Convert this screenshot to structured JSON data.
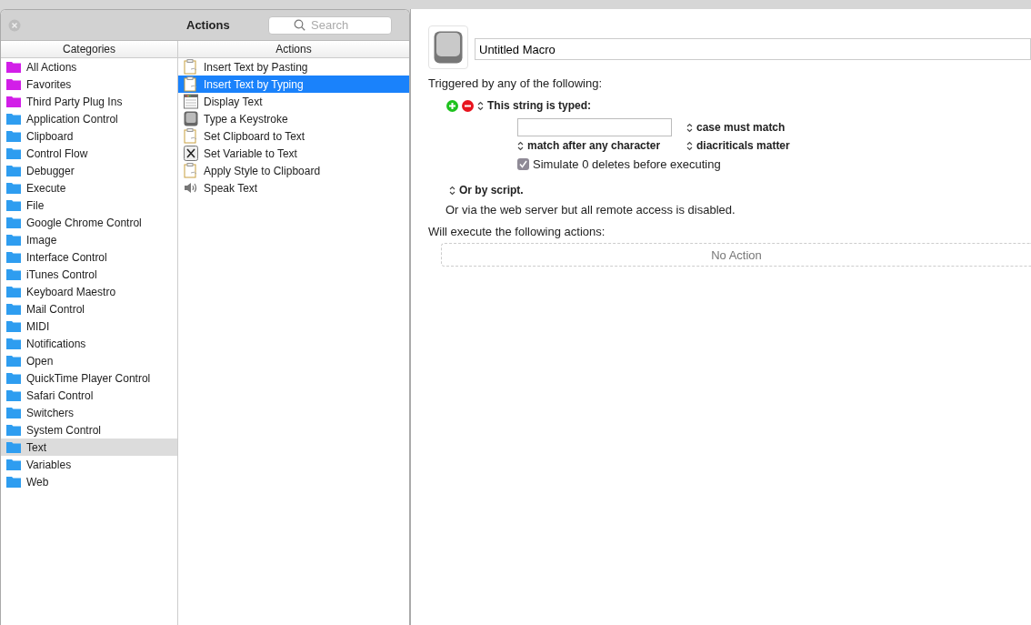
{
  "palette": {
    "title": "Actions",
    "search": {
      "placeholder": "Search"
    },
    "categories": {
      "heading": "Categories",
      "items": [
        {
          "label": "All Actions",
          "color": "#d21ee8",
          "selected": false
        },
        {
          "label": "Favorites",
          "color": "#d21ee8",
          "selected": false
        },
        {
          "label": "Third Party Plug Ins",
          "color": "#d21ee8",
          "selected": false
        },
        {
          "label": "Application Control",
          "color": "#2e9df0",
          "selected": false
        },
        {
          "label": "Clipboard",
          "color": "#2e9df0",
          "selected": false
        },
        {
          "label": "Control Flow",
          "color": "#2e9df0",
          "selected": false
        },
        {
          "label": "Debugger",
          "color": "#2e9df0",
          "selected": false
        },
        {
          "label": "Execute",
          "color": "#2e9df0",
          "selected": false
        },
        {
          "label": "File",
          "color": "#2e9df0",
          "selected": false
        },
        {
          "label": "Google Chrome Control",
          "color": "#2e9df0",
          "selected": false
        },
        {
          "label": "Image",
          "color": "#2e9df0",
          "selected": false
        },
        {
          "label": "Interface Control",
          "color": "#2e9df0",
          "selected": false
        },
        {
          "label": "iTunes Control",
          "color": "#2e9df0",
          "selected": false
        },
        {
          "label": "Keyboard Maestro",
          "color": "#2e9df0",
          "selected": false
        },
        {
          "label": "Mail Control",
          "color": "#2e9df0",
          "selected": false
        },
        {
          "label": "MIDI",
          "color": "#2e9df0",
          "selected": false
        },
        {
          "label": "Notifications",
          "color": "#2e9df0",
          "selected": false
        },
        {
          "label": "Open",
          "color": "#2e9df0",
          "selected": false
        },
        {
          "label": "QuickTime Player Control",
          "color": "#2e9df0",
          "selected": false
        },
        {
          "label": "Safari Control",
          "color": "#2e9df0",
          "selected": false
        },
        {
          "label": "Switchers",
          "color": "#2e9df0",
          "selected": false
        },
        {
          "label": "System Control",
          "color": "#2e9df0",
          "selected": false
        },
        {
          "label": "Text",
          "color": "#2e9df0",
          "selected": true
        },
        {
          "label": "Variables",
          "color": "#2e9df0",
          "selected": false
        },
        {
          "label": "Web",
          "color": "#2e9df0",
          "selected": false
        }
      ]
    },
    "actions": {
      "heading": "Actions",
      "items": [
        {
          "label": "Insert Text by Pasting",
          "kind": "clipboard",
          "selected": false
        },
        {
          "label": "Insert Text by Typing",
          "kind": "clipboard",
          "selected": true
        },
        {
          "label": "Display Text",
          "kind": "window",
          "selected": false
        },
        {
          "label": "Type a Keystroke",
          "kind": "key",
          "selected": false
        },
        {
          "label": "Set Clipboard to Text",
          "kind": "clipboard",
          "selected": false
        },
        {
          "label": "Set Variable to Text",
          "kind": "variable",
          "selected": false
        },
        {
          "label": "Apply Style to Clipboard",
          "kind": "clipboard",
          "selected": false
        },
        {
          "label": "Speak Text",
          "kind": "speaker",
          "selected": false
        }
      ]
    }
  },
  "macro": {
    "name": "Untitled Macro",
    "triggers_heading": "Triggered by any of the following:",
    "trigger": {
      "title": "This string is typed:",
      "case_option": "case must match",
      "match_option": "match after any character",
      "diacritics_option": "diacriticals matter",
      "simulate": {
        "label": "Simulate 0 deletes before executing",
        "checked": true
      }
    },
    "script_trigger": "Or by script.",
    "web_note": "Or via the web server but all remote access is disabled.",
    "actions_heading": "Will execute the following actions:",
    "empty_actions": "No Action"
  }
}
